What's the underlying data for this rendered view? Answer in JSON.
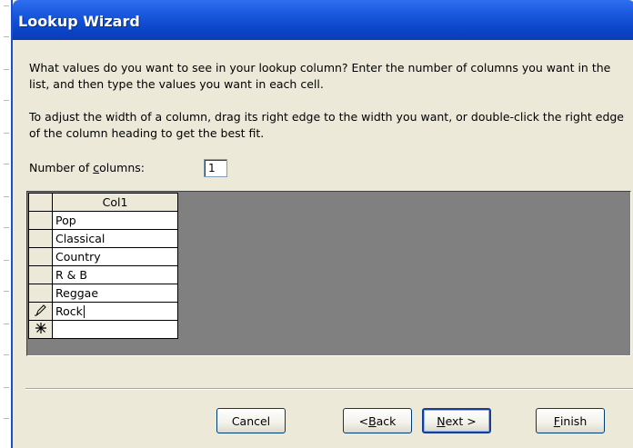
{
  "window": {
    "title": "Lookup Wizard"
  },
  "instructions": {
    "p1": "What values do you want to see in your lookup column? Enter the number of columns you want in the list, and then type the values you want in each cell.",
    "p2": "To adjust the width of a column, drag its right edge to the width you want, or double-click the right edge of the column heading to get the best fit."
  },
  "columns_field": {
    "label_before": "Number of ",
    "label_accel": "c",
    "label_after": "olumns:",
    "value": "1"
  },
  "grid": {
    "header": "Col1",
    "rows": [
      {
        "selector": "",
        "value": "Pop"
      },
      {
        "selector": "",
        "value": "Classical"
      },
      {
        "selector": "",
        "value": "Country"
      },
      {
        "selector": "",
        "value": "R & B"
      },
      {
        "selector": "",
        "value": "Reggae"
      },
      {
        "selector": "pencil-icon",
        "value": "Rock"
      },
      {
        "selector": "new-row-icon",
        "value": ""
      }
    ]
  },
  "buttons": {
    "cancel": "Cancel",
    "back": {
      "accel": "B",
      "rest": "ack",
      "prefix": "< "
    },
    "next": {
      "accel": "N",
      "rest": "ext >"
    },
    "finish": {
      "accel": "F",
      "rest": "inish"
    }
  }
}
